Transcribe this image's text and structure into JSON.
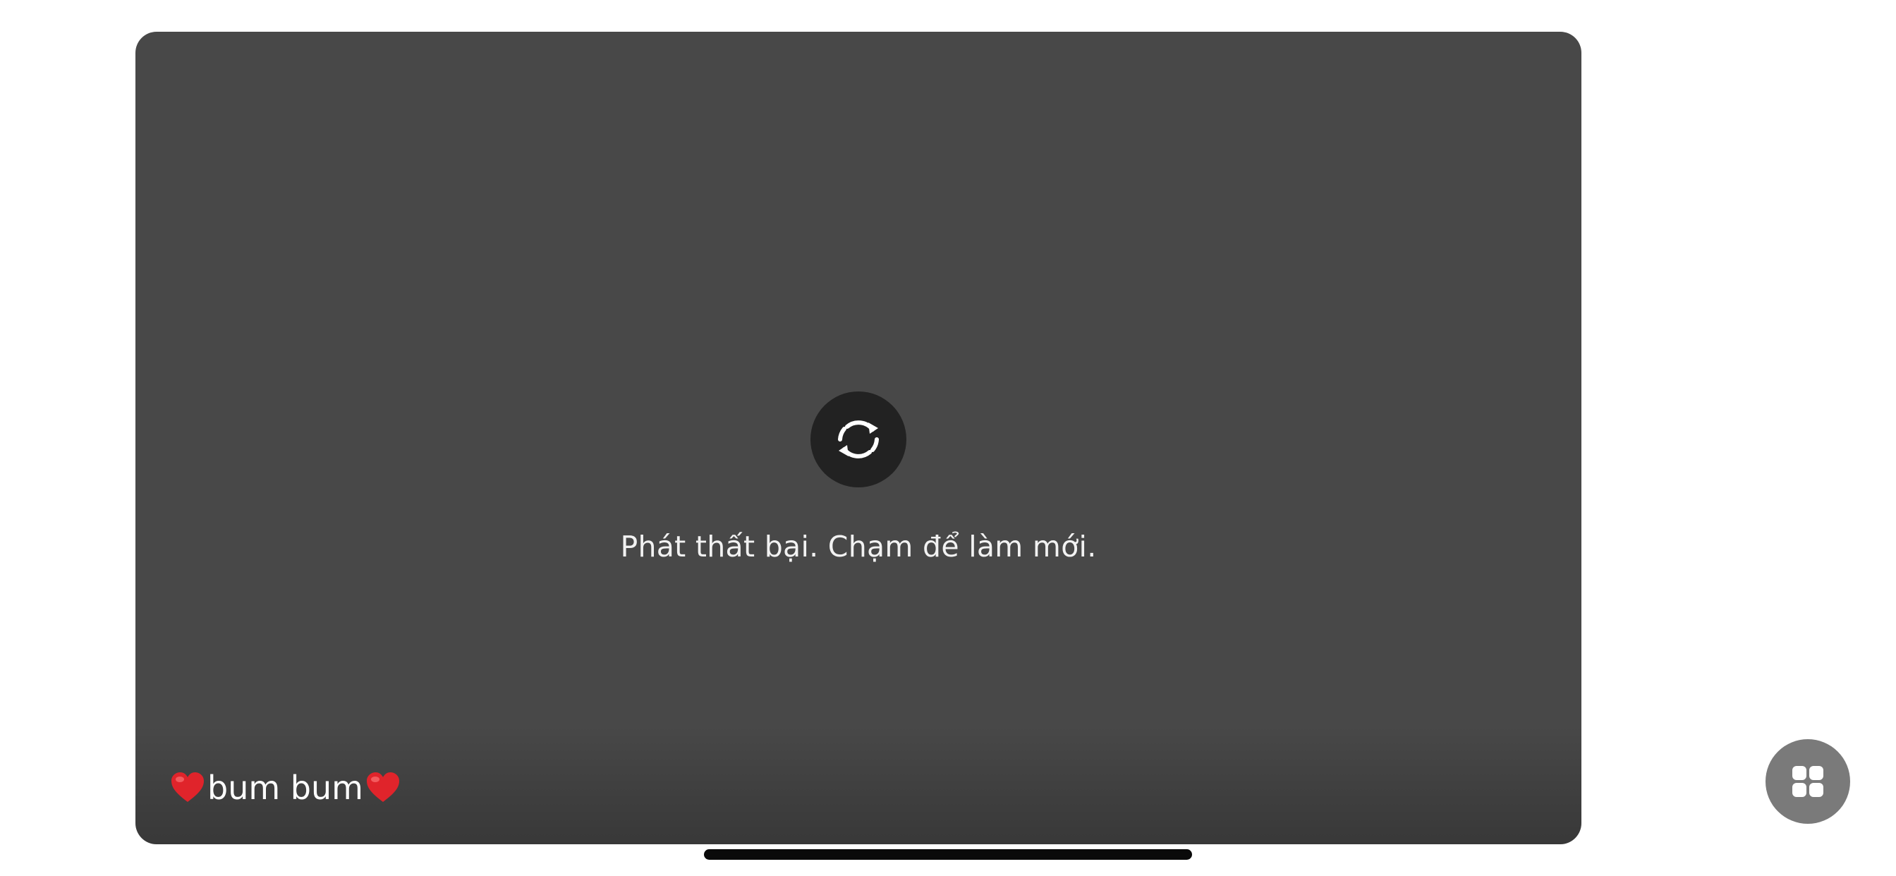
{
  "player": {
    "error_message": "Phát thất bại. Chạm để làm mới.",
    "title_text": "bum bum",
    "retry_icon": "refresh-icon",
    "title_icon": "red-heart-icon"
  },
  "floating_button": {
    "icon": "grid-icon"
  },
  "colors": {
    "player_bg": "#484848",
    "retry_bg": "#222222",
    "heart": "#e0242b",
    "fab_bg": "#7a7a7a"
  }
}
